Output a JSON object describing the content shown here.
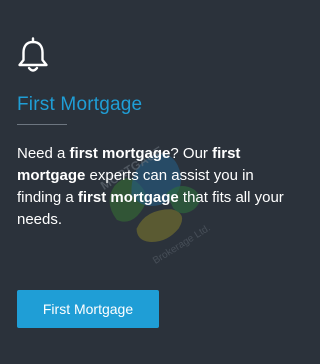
{
  "colors": {
    "background": "#2b323b",
    "accent": "#1f9ed6",
    "text": "#ffffff",
    "divider": "#6d7680"
  },
  "card": {
    "icon": "bell-icon",
    "title": "First Mortgage",
    "description": [
      {
        "text": "Need a ",
        "bold": false
      },
      {
        "text": "first mortgage",
        "bold": true
      },
      {
        "text": "? Our ",
        "bold": false
      },
      {
        "text": "first mortgage",
        "bold": true
      },
      {
        "text": " experts can assist you in finding a ",
        "bold": false
      },
      {
        "text": "first mortgage",
        "bold": true
      },
      {
        "text": " that fits all your needs.",
        "bold": false
      }
    ],
    "button_label": "First Mortgage"
  },
  "watermark": {
    "text_lines": [
      "MORTGAGE",
      "Brokerage Ltd."
    ]
  }
}
